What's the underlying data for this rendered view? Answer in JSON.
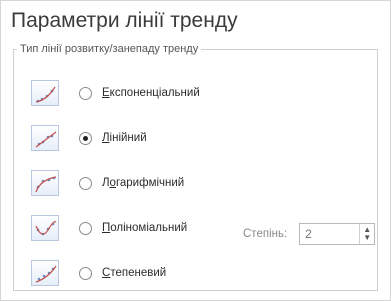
{
  "dialog": {
    "title": "Параметри лінії тренду",
    "group_title": "Тип лінії розвитку/занепаду тренду"
  },
  "options": [
    {
      "label": "Експоненціальний",
      "hot": "Е",
      "checked": false,
      "icon": "exponential-trend-icon"
    },
    {
      "label": "Лінійний",
      "hot": "Л",
      "checked": true,
      "icon": "linear-trend-icon"
    },
    {
      "label": "Логарифмічний",
      "hot": "о",
      "checked": false,
      "icon": "logarithmic-trend-icon"
    },
    {
      "label": "Поліноміальний",
      "hot": "П",
      "checked": false,
      "icon": "polynomial-trend-icon"
    },
    {
      "label": "Степеневий",
      "hot": "С",
      "checked": false,
      "icon": "power-trend-icon"
    }
  ],
  "degree": {
    "label": "Степінь:",
    "value": "2"
  }
}
